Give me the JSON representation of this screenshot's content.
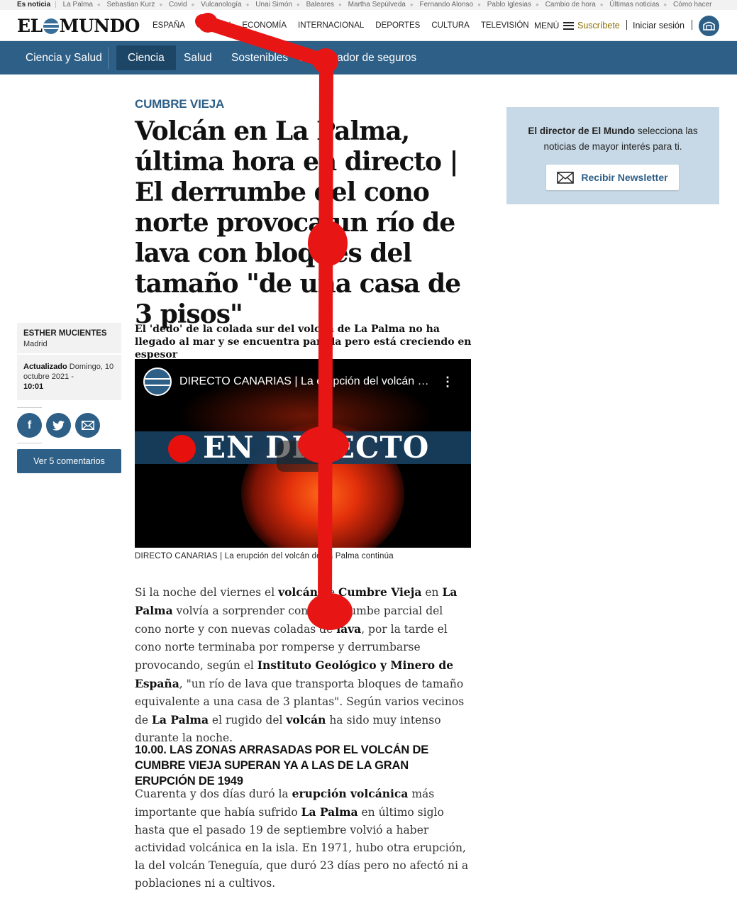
{
  "ticker": {
    "label": "Es noticia",
    "items": [
      "La Palma",
      "Sebastian Kurz",
      "Covid",
      "Vulcanología",
      "Unai Simón",
      "Baleares",
      "Martha Sepúlveda",
      "Fernando Alonso",
      "Pablo Iglesias",
      "Cambio de hora",
      "Últimas noticias",
      "Cómo hacer"
    ]
  },
  "header": {
    "logo_left": "EL",
    "logo_right": "MUNDO",
    "nav": [
      "ESPAÑA",
      "OPINIÓN",
      "ECONOMÍA",
      "INTERNACIONAL",
      "DEPORTES",
      "CULTURA",
      "TELEVISIÓN"
    ],
    "menu_label": "MENÚ",
    "subscribe_label": "Suscríbete",
    "login_label": "Iniciar sesión"
  },
  "section_bar": {
    "section": "Ciencia y Salud",
    "tabs": [
      "Ciencia",
      "Salud",
      "Sostenibles",
      "Comparador de seguros"
    ],
    "active_tab": "Ciencia"
  },
  "article": {
    "kicker": "CUMBRE VIEJA",
    "headline": "Volcán en La Palma, última hora en directo | El derrumbe del cono norte provoca un río de lava con bloques del tamaño \"de una casa de 3 pisos\"",
    "standfirst": "El 'dedo' de la colada sur del volcán de La Palma no ha llegado al mar y se encuentra parada pero está creciendo en espesor",
    "author": "ESTHER MUCIENTES",
    "city": "Madrid",
    "updated_label": "Actualizado",
    "updated_date": "Domingo, 10 octubre 2021 -",
    "updated_time": "10:01",
    "comments_button": "Ver 5 comentarios",
    "video_title": "DIRECTO CANARIAS | La erupción del volcán de La Palma continúa",
    "video_banner": "EN DIRECTO",
    "caption": "DIRECTO CANARIAS | La erupción del volcán de La Palma continúa",
    "subhead": "10.00. Las zonas arrasadas por el volcán de Cumbre Vieja superan ya a las de la gran erupción de 1949"
  },
  "newsletter": {
    "text_bold": "El director de El Mundo",
    "text_rest": "selecciona las noticias de mayor interés para ti.",
    "button": "Recibir Newsletter"
  },
  "colors": {
    "brand_blue": "#2d5f87",
    "brand_blue_dark": "#1d4565",
    "subscribe_gold": "#8a6d00",
    "newsletter_bg": "#c7d9e6",
    "scribble_red": "#e81515"
  },
  "icons": [
    "globe-logo-icon",
    "hamburger-icon",
    "user-icon",
    "facebook-icon",
    "twitter-icon",
    "mail-icon",
    "envelope-icon",
    "record-dot-icon",
    "kebab-icon"
  ]
}
